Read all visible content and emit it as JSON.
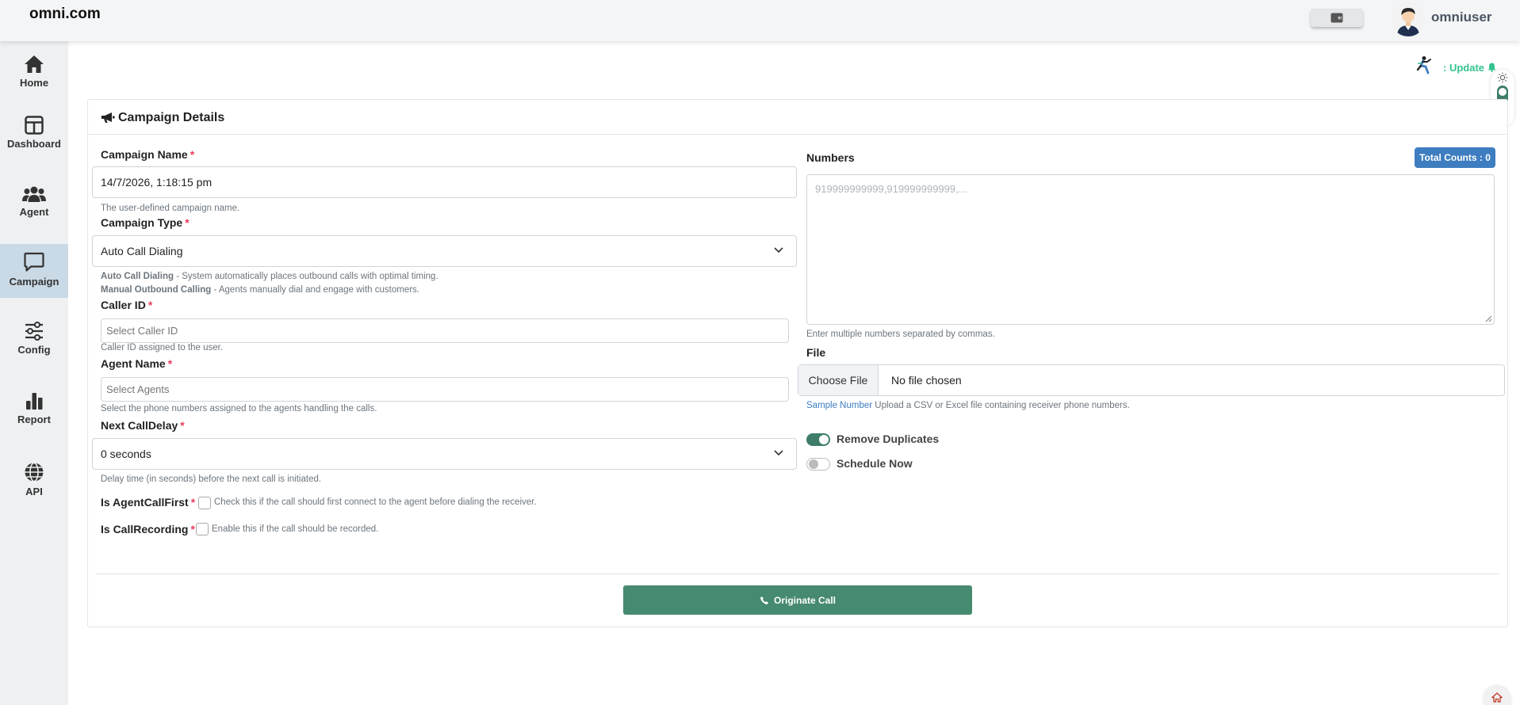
{
  "header": {
    "brand": "omni.com",
    "username": "omniuser"
  },
  "sidebar": {
    "items": [
      {
        "label": "Home",
        "icon": "home-icon"
      },
      {
        "label": "Dashboard",
        "icon": "dashboard-icon"
      },
      {
        "label": "Agent",
        "icon": "users-icon"
      },
      {
        "label": "Campaign",
        "icon": "chat-icon",
        "active": true
      },
      {
        "label": "Config",
        "icon": "sliders-icon"
      },
      {
        "label": "Report",
        "icon": "bar-chart-icon"
      },
      {
        "label": "API",
        "icon": "globe-icon"
      }
    ]
  },
  "update": {
    "text": ": Update"
  },
  "card": {
    "title": "Campaign Details"
  },
  "form": {
    "campaign_name": {
      "label": "Campaign Name",
      "value": "14/7/2026, 1:18:15 pm",
      "hint": "The user-defined campaign name."
    },
    "campaign_type": {
      "label": "Campaign Type",
      "value": "Auto Call Dialing",
      "hint1_bold": "Auto Call Dialing",
      "hint1_rest": " - System automatically places outbound calls with optimal timing.",
      "hint2_bold": "Manual Outbound Calling",
      "hint2_rest": " - Agents manually dial and engage with customers."
    },
    "caller_id": {
      "label": "Caller ID",
      "placeholder": "Select Caller ID",
      "hint": "Caller ID assigned to the user."
    },
    "agent_name": {
      "label": "Agent Name",
      "placeholder": "Select Agents",
      "hint": "Select the phone numbers assigned to the agents handling the calls."
    },
    "next_call_delay": {
      "label": "Next CallDelay",
      "value": "0 seconds",
      "hint": "Delay time (in seconds) before the next call is initiated."
    },
    "agent_call_first": {
      "label": "Is AgentCallFirst",
      "hint": "Check this if the call should first connect to the agent before dialing the receiver."
    },
    "call_recording": {
      "label": "Is CallRecording",
      "hint": "Enable this if the call should be recorded."
    },
    "required_mark": "*"
  },
  "numbers": {
    "label": "Numbers",
    "count_badge": "Total Counts : 0",
    "placeholder": "919999999999,919999999999,...",
    "hint": "Enter multiple numbers separated by commas."
  },
  "file": {
    "label": "File",
    "button": "Choose File",
    "status": "No file chosen",
    "sample_link": "Sample Number",
    "hint": " Upload a CSV or Excel file containing receiver phone numbers."
  },
  "toggles": {
    "remove_duplicates": {
      "label": "Remove Duplicates",
      "on": true
    },
    "schedule_now": {
      "label": "Schedule Now",
      "on": false
    }
  },
  "actions": {
    "originate": "Originate Call"
  },
  "colors": {
    "accent": "#468a6f",
    "badge": "#3e7dc0",
    "active_nav": "#c9d9e6",
    "required": "#e83e5d",
    "update": "#34c38f"
  }
}
